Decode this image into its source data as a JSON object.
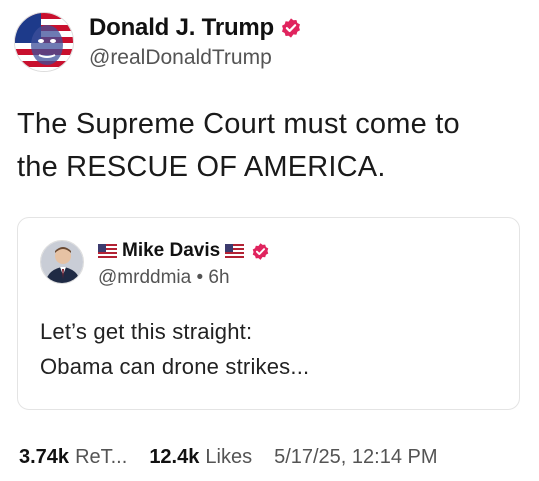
{
  "post": {
    "author": {
      "display_name": "Donald J. Trump",
      "handle": "@realDonaldTrump",
      "verified": true,
      "avatar_icon": "user-avatar",
      "verified_color": "#e0245e"
    },
    "text_line1": "The Supreme Court must come to",
    "text_line2": "the RESCUE OF AMERICA.",
    "quote": {
      "display_name": "Mike Davis",
      "handle": "@mrddmia",
      "separator": "•",
      "time": "6h",
      "flag_icon": "us-flag-icon",
      "text_line1": "Let’s get this straight:",
      "text_line2": "Obama can drone strikes..."
    },
    "stats": {
      "retruths_count": "3.74k",
      "retruths_label": "ReT...",
      "likes_count": "12.4k",
      "likes_label": "Likes",
      "timestamp": "5/17/25, 12:14 PM"
    }
  }
}
